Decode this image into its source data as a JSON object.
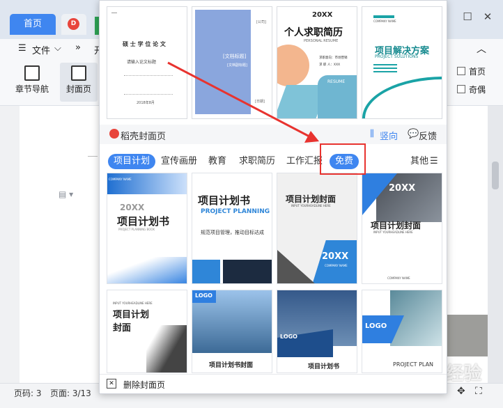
{
  "tabs": {
    "home": "首页"
  },
  "menu": {
    "file": "文件",
    "more": "»",
    "cut_off": "开"
  },
  "ribbon": {
    "chapter_nav": "章节导航",
    "cover_page": "封面页",
    "checkbox1": "首页",
    "checkbox2": "奇偶"
  },
  "status": {
    "page_code": "页码: 3",
    "page_count": "页面: 3/13"
  },
  "popup": {
    "top_covers": [
      {
        "title": "硕 士 学 位 论 文",
        "subtitle": "请输入论文标题",
        "year": "2018年8月"
      },
      {
        "title": "[文档标题]",
        "subtitle": "[文档副标题]",
        "corner": "[公司]",
        "date": "[日期]"
      },
      {
        "year": "20XX",
        "title": "个人求职简历",
        "subtitle": "PERSONAL RESUME",
        "field1": "求职意向：市场营销",
        "field2": "求 职 人：XXX",
        "badge": "RESUME"
      },
      {
        "company": "COMPANY NAME",
        "title": "项目解决方案",
        "subtitle": "PROJECT SOLUTIONS"
      }
    ],
    "brand": "稻壳封面页",
    "vertical": "竖向",
    "feedback": "反馈",
    "categories": [
      "项目计划",
      "宣传画册",
      "教育",
      "求职简历",
      "工作汇报",
      "免费"
    ],
    "others": "其他",
    "grid": [
      {
        "year": "20XX",
        "title": "项目计划书",
        "subtitle": "PROJECT PLANNING BOOK",
        "company": "COMPANY NAME"
      },
      {
        "title": "项目计划书",
        "subtitle": "PROJECT PLANNING",
        "slogan": "规范项目管理，推动目标达成"
      },
      {
        "title": "项目计划封面",
        "subtitle": "INPUT YOURHEADLINE HERE",
        "year": "20XX",
        "company": "COMPANY NAME"
      },
      {
        "year": "20XX",
        "title": "项目计划封面",
        "subtitle": "INPUT YOURHEADLINE HERE",
        "company": "COMPANY NAME"
      },
      {
        "head": "INPUT YOURHEADLINE HERE",
        "title": "项目计划\n封面"
      },
      {
        "logo": "LOGO",
        "title": "项目计划书封面"
      },
      {
        "logo": "LOGO",
        "title": "项目计划书"
      },
      {
        "logo": "LOGO",
        "title": "PROJECT PLAN"
      }
    ],
    "delete": "删除封面页"
  },
  "watermark": "Baidu经验"
}
